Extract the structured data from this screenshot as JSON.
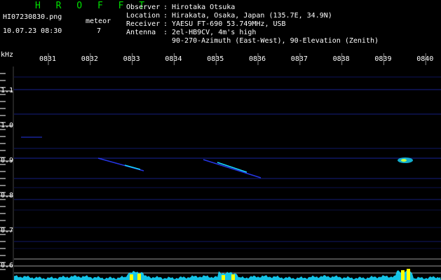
{
  "header": {
    "brand": "H R O F F T",
    "filename": "HI07230830.png",
    "datetime": "10.07.23 08:30",
    "meteor_label": "meteor",
    "meteor_count": "7"
  },
  "info": {
    "observer_key": "Observer",
    "observer_val": "Hirotaka Otsuka",
    "location_key": "Location",
    "location_val": "Hirakata, Osaka, Japan (135.7E, 34.9N)",
    "receiver_key": "Receiver",
    "receiver_val": "YAESU FT-690 53.749MHz, USB",
    "antenna_key": "Antenna",
    "antenna_val": "2el-HB9CV, 4m's high",
    "antenna_val2": "90-270-Azimuth (East-West), 90-Elevation (Zenith)"
  },
  "axes": {
    "y_unit": "kHz",
    "x_ticks": [
      "0831",
      "0832",
      "0833",
      "0834",
      "0835",
      "0836",
      "0837",
      "0838",
      "0839",
      "0840"
    ],
    "y_ticks": [
      "1.1",
      "1.0",
      "0.9",
      "0.8",
      "0.7",
      "0.6"
    ]
  },
  "colors": {
    "brand": "#00e000",
    "trace": "#2a3cff",
    "noise": "#16d8ff",
    "peak": "#ffff00",
    "grid": "#888888"
  }
}
